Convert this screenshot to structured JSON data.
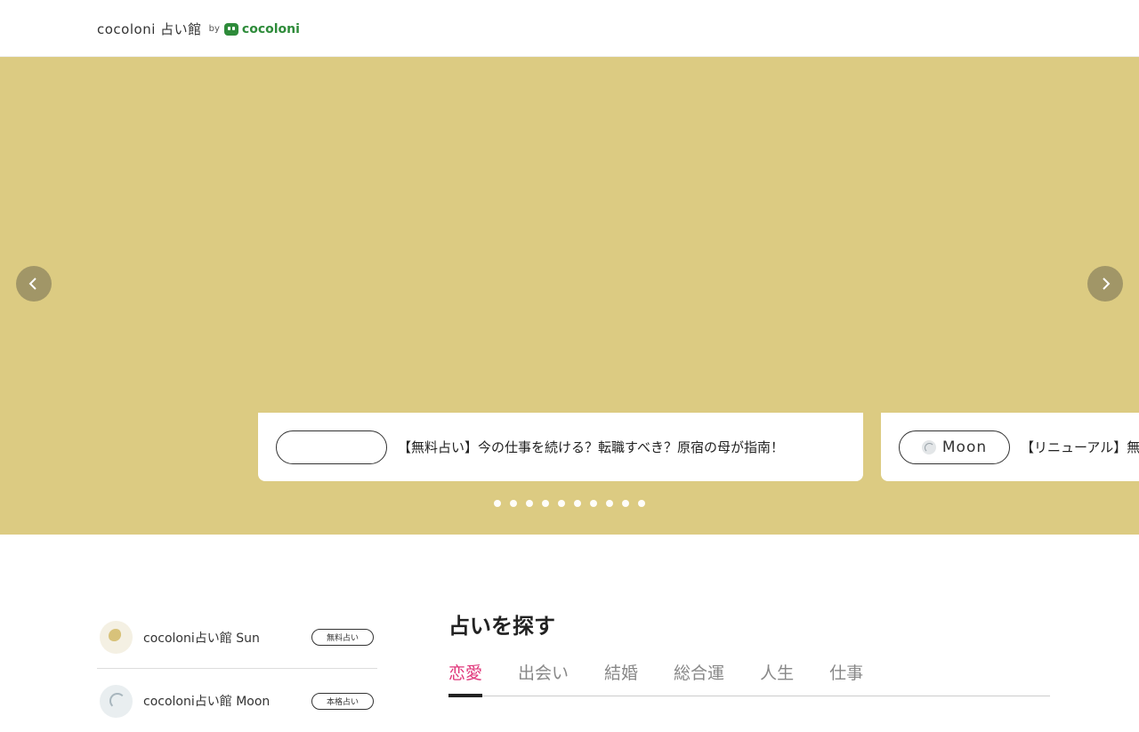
{
  "header": {
    "logo_text": "cocoloni 占い館",
    "by_text": "by",
    "brand_text": "cocoloni"
  },
  "hero": {
    "slides": [
      {
        "pill_label": "",
        "text": "【無料占い】今の仕事を続ける？転職すべき？原宿の母が指南！"
      },
      {
        "pill_label": "Moon",
        "text": "【リニューアル】無カ"
      }
    ],
    "dot_count": 10,
    "background_color": "#dccb82"
  },
  "sidebar": {
    "items": [
      {
        "name": "cocoloni占い館 Sun",
        "badge": "無料占い",
        "icon": "sun-icon"
      },
      {
        "name": "cocoloni占い館 Moon",
        "badge": "本格占い",
        "icon": "moon-icon"
      }
    ]
  },
  "search": {
    "title": "占いを探す",
    "tabs": [
      {
        "label": "恋愛",
        "active": true
      },
      {
        "label": "出会い",
        "active": false
      },
      {
        "label": "結婚",
        "active": false
      },
      {
        "label": "総合運",
        "active": false
      },
      {
        "label": "人生",
        "active": false
      },
      {
        "label": "仕事",
        "active": false
      }
    ],
    "accent_color": "#e0367a"
  }
}
